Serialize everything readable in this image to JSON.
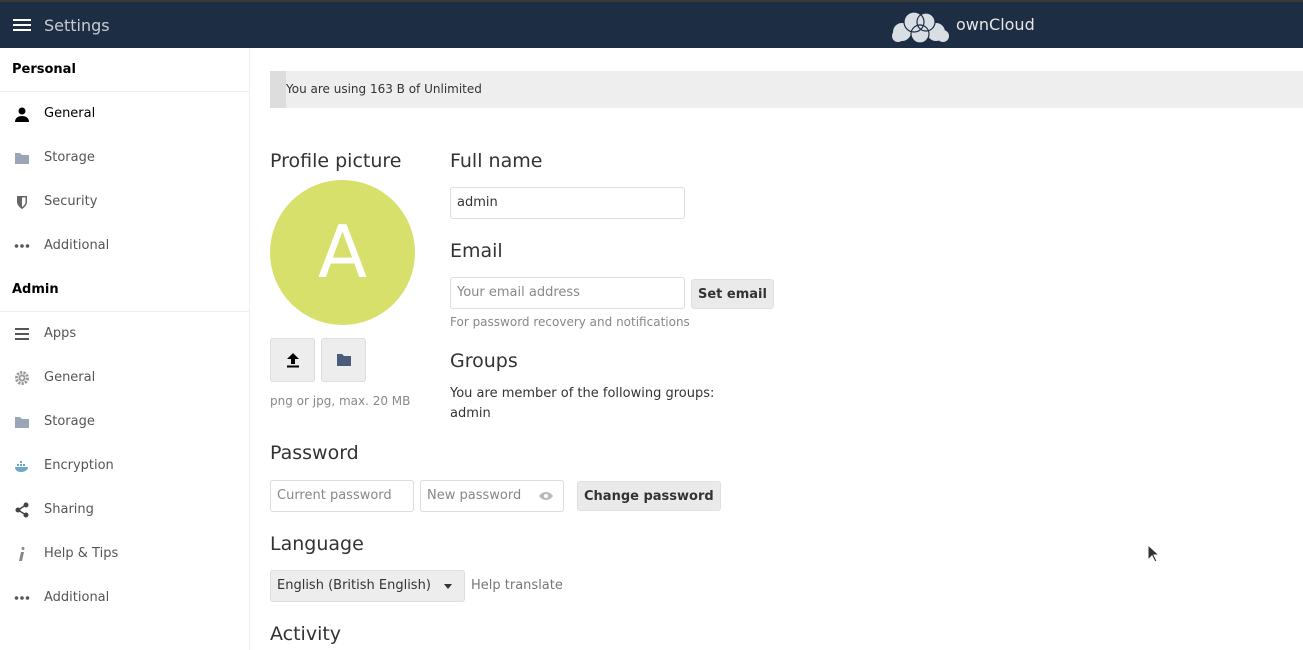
{
  "header": {
    "title": "Settings",
    "brand": "ownCloud"
  },
  "sidebar": {
    "personal_heading": "Personal",
    "personal_items": [
      {
        "label": "General",
        "icon": "user-icon"
      },
      {
        "label": "Storage",
        "icon": "folder-icon"
      },
      {
        "label": "Security",
        "icon": "shield-icon"
      },
      {
        "label": "Additional",
        "icon": "more-icon"
      }
    ],
    "admin_heading": "Admin",
    "admin_items": [
      {
        "label": "Apps",
        "icon": "list-icon"
      },
      {
        "label": "General",
        "icon": "gear-icon"
      },
      {
        "label": "Storage",
        "icon": "folder-icon"
      },
      {
        "label": "Encryption",
        "icon": "docker-icon"
      },
      {
        "label": "Sharing",
        "icon": "share-icon"
      },
      {
        "label": "Help & Tips",
        "icon": "info-icon"
      },
      {
        "label": "Additional",
        "icon": "more-icon"
      }
    ]
  },
  "quota": {
    "text": "You are using 163 B of Unlimited"
  },
  "profile": {
    "heading": "Profile picture",
    "avatar_letter": "A",
    "hint": "png or jpg, max. 20 MB"
  },
  "fullname": {
    "heading": "Full name",
    "value": "admin"
  },
  "email": {
    "heading": "Email",
    "placeholder": "Your email address",
    "button": "Set email",
    "hint": "For password recovery and notifications"
  },
  "groups": {
    "heading": "Groups",
    "text": "You are member of the following groups:",
    "list": "admin"
  },
  "password": {
    "heading": "Password",
    "current_placeholder": "Current password",
    "new_placeholder": "New password",
    "button": "Change password"
  },
  "language": {
    "heading": "Language",
    "selected": "English (British English)",
    "link": "Help translate"
  },
  "activity": {
    "heading": "Activity"
  },
  "colors": {
    "topbar": "#1d2d44",
    "avatar": "#d6e06a"
  }
}
